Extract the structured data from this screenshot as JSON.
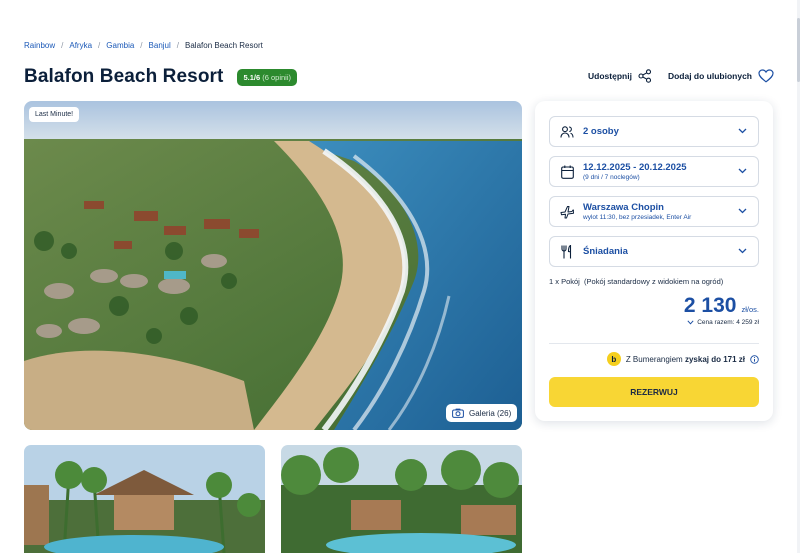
{
  "breadcrumb": [
    {
      "label": "Rainbow"
    },
    {
      "label": "Afryka"
    },
    {
      "label": "Gambia"
    },
    {
      "label": "Banjul"
    }
  ],
  "breadcrumb_current": "Balafon Beach Resort",
  "hotel": {
    "name": "Balafon Beach Resort",
    "rating": "5.1/6",
    "reviews": "(6 opinii)"
  },
  "actions": {
    "share": "Udostępnij",
    "favorite": "Dodaj do ulubionych"
  },
  "gallery": {
    "tag": "Last Minute!",
    "button": "Galeria (26)"
  },
  "booking": {
    "persons": "2 osoby",
    "dates": "12.12.2025 - 20.12.2025",
    "dates_sub": "(9 dni / 7 noclegów)",
    "airport": "Warszawa Chopin",
    "airport_sub": "wylot 11:30, bez przesiadek, Enter Air",
    "board": "Śniadania",
    "room": "1 x Pokój",
    "room_desc": "(Pokój standardowy z widokiem na ogród)",
    "price": "2 130",
    "price_unit": "zł/os.",
    "total": "Cena razem: 4 259 zł",
    "bumerang_prefix": "Z Bumerangiem",
    "bumerang_bold": "zyskaj do 171 zł",
    "reserve": "REZERWUJ"
  },
  "icons": {
    "persons": "users-icon",
    "dates": "calendar-icon",
    "airport": "plane-icon",
    "board": "cutlery-icon",
    "share": "share-icon",
    "favorite": "heart-icon",
    "gallery": "camera-icon",
    "info": "info-icon"
  },
  "colors": {
    "brand_blue": "#1c4fa3",
    "rating_green": "#2c8a2e",
    "reserve_yellow": "#f8d634"
  }
}
